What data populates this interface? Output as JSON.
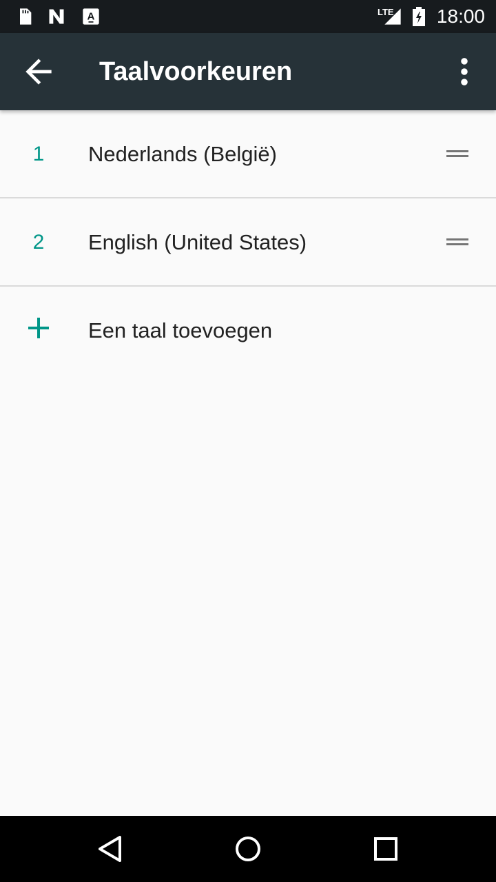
{
  "status_bar": {
    "time": "18:00",
    "network": "LTE",
    "icons": [
      "sd-card-icon",
      "n-icon",
      "a-keyboard-icon",
      "signal-icon",
      "battery-charging-icon"
    ]
  },
  "app_bar": {
    "title": "Taalvoorkeuren",
    "back_icon": "arrow-back-icon",
    "menu_icon": "more-vert-icon"
  },
  "languages": [
    {
      "index": "1",
      "name": "Nederlands (België)"
    },
    {
      "index": "2",
      "name": "English (United States)"
    }
  ],
  "add_language": {
    "label": "Een taal toevoegen",
    "icon": "plus-icon"
  },
  "colors": {
    "accent": "#009688",
    "app_bar": "#263238",
    "status_bar": "#171b1e",
    "background": "#fafafa"
  },
  "nav_bar": {
    "buttons": [
      "back-triangle-icon",
      "home-circle-icon",
      "recents-square-icon"
    ]
  }
}
